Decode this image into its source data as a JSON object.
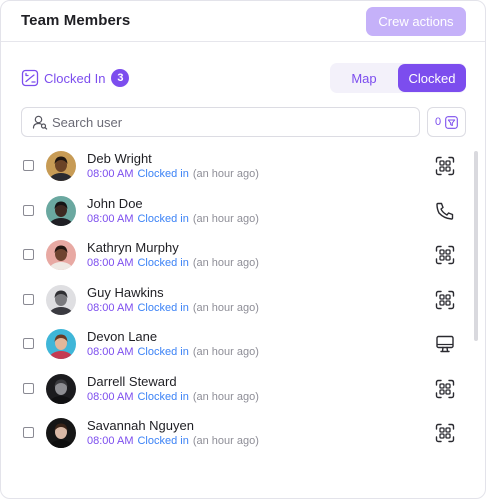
{
  "header": {
    "title": "Team Members",
    "crew_button": "Crew actions"
  },
  "filter": {
    "label": "Clocked In",
    "count": "3",
    "toggle": {
      "map": "Map",
      "clocked": "Clocked",
      "selected": "Clocked"
    }
  },
  "search": {
    "placeholder": "Search user",
    "value": "",
    "filter_count": "0"
  },
  "members": [
    {
      "name": "Deb Wright",
      "time": "08:00 AM",
      "status": "Clocked in",
      "ago": "(an hour ago)",
      "device": "face-id-icon",
      "avatar_bg": "#c79b55",
      "avatar_skin": "#6b4326",
      "avatar_hair": "#1e1510",
      "avatar_shirt": "#2a2a30"
    },
    {
      "name": "John Doe",
      "time": "08:00 AM",
      "status": "Clocked in",
      "ago": "(an hour ago)",
      "device": "phone-icon",
      "avatar_bg": "#6aa8a0",
      "avatar_skin": "#3d2a22",
      "avatar_hair": "#151515",
      "avatar_shirt": "#1f1f24"
    },
    {
      "name": "Kathryn Murphy",
      "time": "08:00 AM",
      "status": "Clocked in",
      "ago": "(an hour ago)",
      "device": "face-id-icon",
      "avatar_bg": "#e8a9a3",
      "avatar_skin": "#6e4330",
      "avatar_hair": "#241611",
      "avatar_shirt": "#efe9e4"
    },
    {
      "name": "Guy Hawkins",
      "time": "08:00 AM",
      "status": "Clocked in",
      "ago": "(an hour ago)",
      "device": "face-id-icon",
      "avatar_bg": "#dfdfe2",
      "avatar_skin": "#7a7a7e",
      "avatar_hair": "#2f2f33",
      "avatar_shirt": "#3a3a40"
    },
    {
      "name": "Devon Lane",
      "time": "08:00 AM",
      "status": "Clocked in",
      "ago": "(an hour ago)",
      "device": "monitor-icon",
      "avatar_bg": "#3fb6d8",
      "avatar_skin": "#e2b79a",
      "avatar_hair": "#6a3a24",
      "avatar_shirt": "#c43b52"
    },
    {
      "name": "Darrell Steward",
      "time": "08:00 AM",
      "status": "Clocked in",
      "ago": "(an hour ago)",
      "device": "face-id-icon",
      "avatar_bg": "#1b1b1e",
      "avatar_skin": "#8d8d92",
      "avatar_hair": "#3a3a3e",
      "avatar_shirt": "#101012"
    },
    {
      "name": "Savannah Nguyen",
      "time": "08:00 AM",
      "status": "Clocked in",
      "ago": "(an hour ago)",
      "device": "face-id-icon",
      "avatar_bg": "#161616",
      "avatar_skin": "#d9b9a6",
      "avatar_hair": "#3a2418",
      "avatar_shirt": "#0e0e0e"
    }
  ],
  "colors": {
    "accent": "#7c4dee",
    "accent_light": "#c5b1f9",
    "status_blue": "#3b82f6",
    "muted": "#8e8e97"
  }
}
